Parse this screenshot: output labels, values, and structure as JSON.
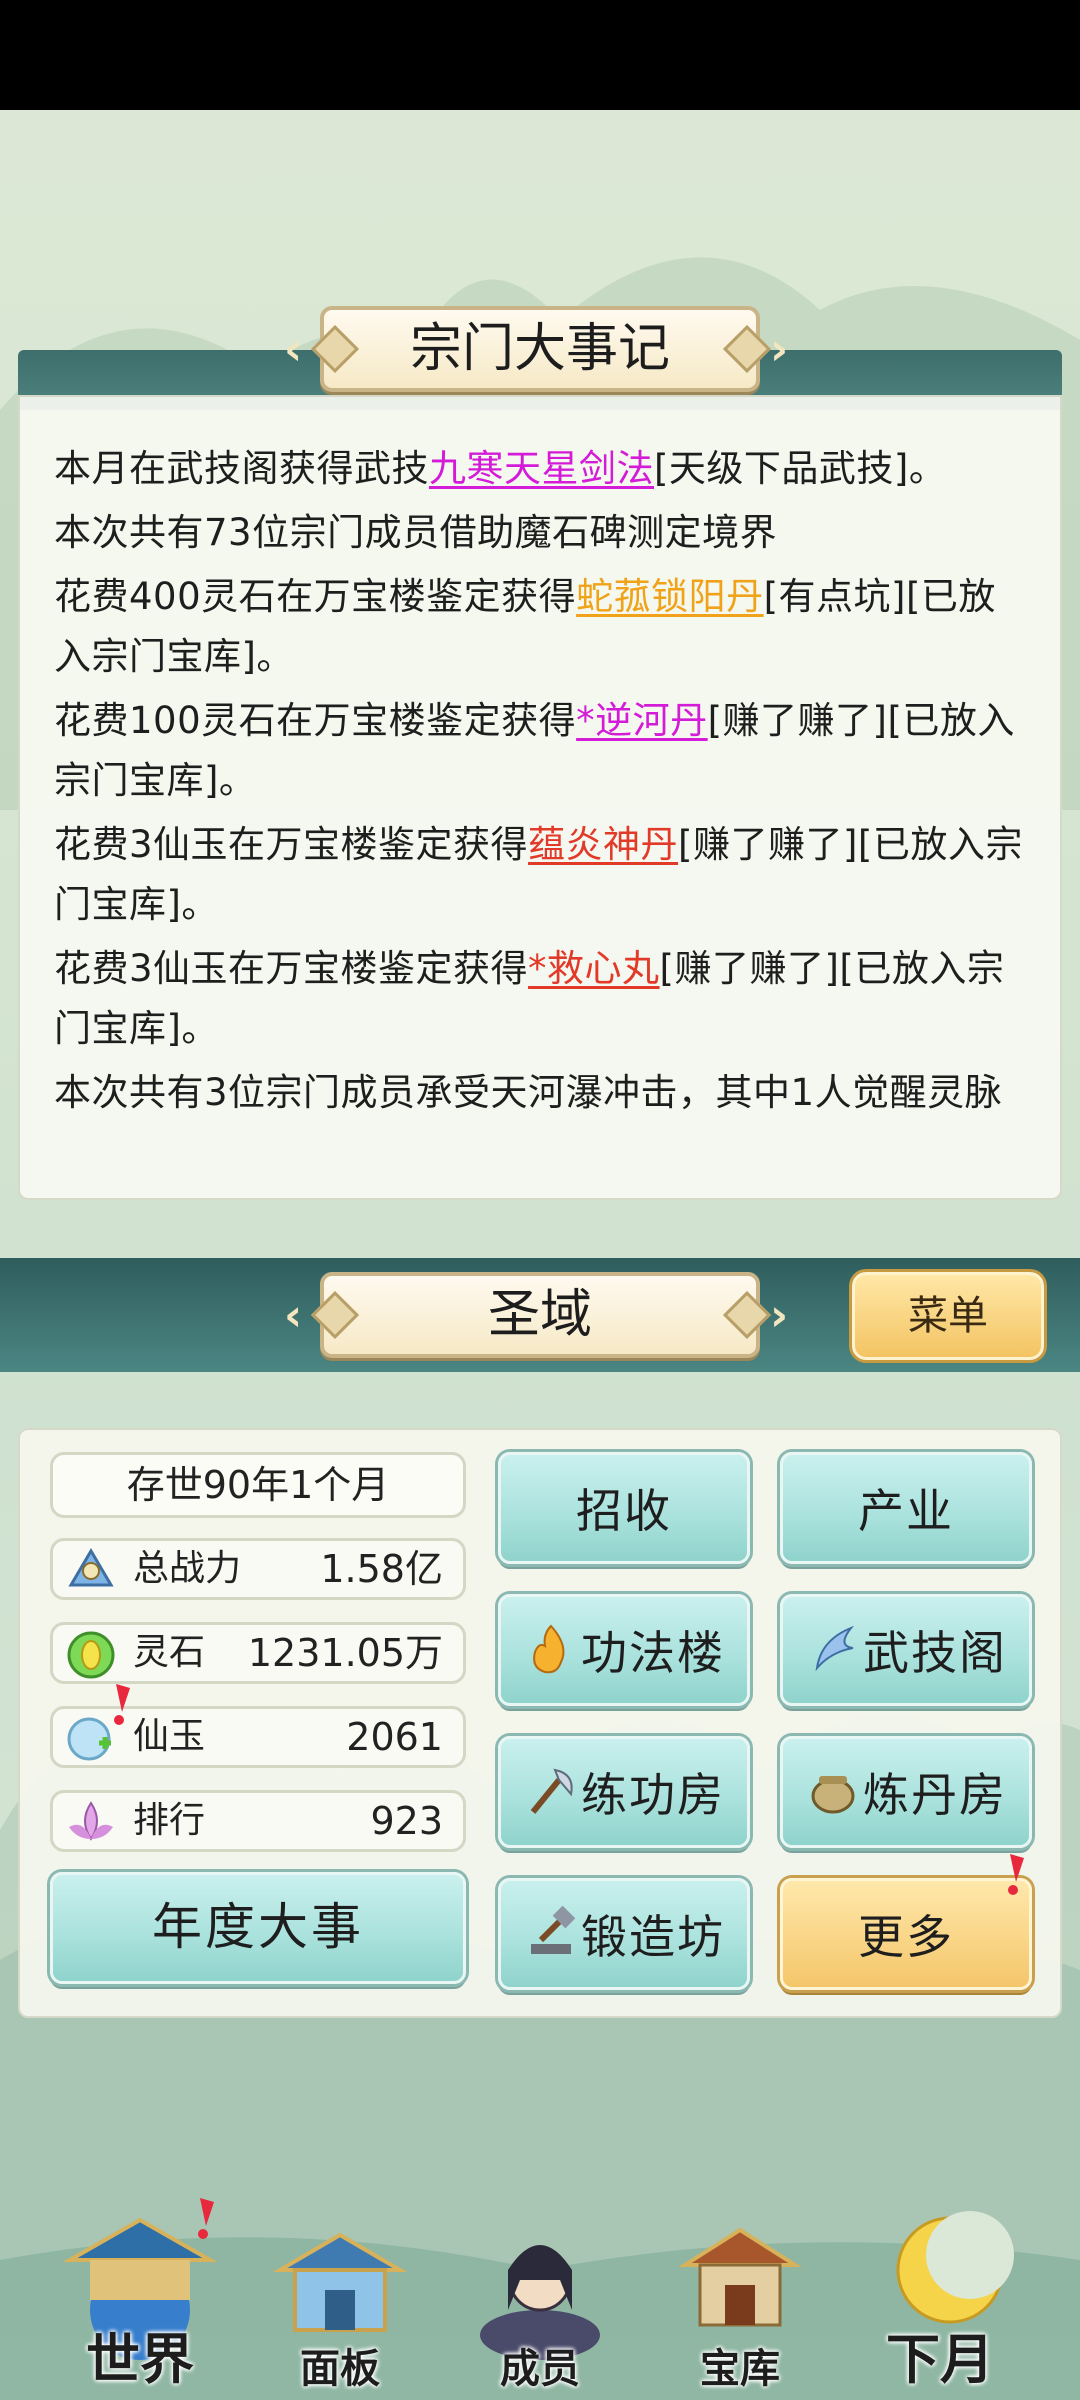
{
  "events": {
    "title": "宗门大事记",
    "lines": [
      {
        "pre": "本月在武技阁获得武技",
        "hl": "九寒天星剑法",
        "post": "[天级下品武技]。"
      },
      {
        "pre": "本次共有73位宗门成员借助魔石碑测定境界",
        "hl": "",
        "post": ""
      },
      {
        "pre": "花费400灵石在万宝楼鉴定获得",
        "hl": "蛇菰锁阳丹",
        "post": "[有点坑][已放入宗门宝库]。"
      },
      {
        "pre": "花费100灵石在万宝楼鉴定获得",
        "hl": "*逆河丹",
        "post": "[赚了赚了][已放入宗门宝库]。"
      },
      {
        "pre": "花费3仙玉在万宝楼鉴定获得",
        "hl": "蕴炎神丹",
        "post": "[赚了赚了][已放入宗门宝库]。"
      },
      {
        "pre": "花费3仙玉在万宝楼鉴定获得",
        "hl": "*救心丸",
        "post": "[赚了赚了][已放入宗门宝库]。"
      },
      {
        "pre": "本次共有3位宗门成员承受天河瀑冲击，其中1人觉醒灵脉",
        "hl": "",
        "post": ""
      }
    ]
  },
  "colors": {
    "purple": "#d41bd8",
    "orange": "#f0a218",
    "red": "#e23a28"
  },
  "holy": {
    "title": "圣域",
    "menu_label": "菜单"
  },
  "stats": {
    "age": "存世90年1个月",
    "power_label": "总战力",
    "power_value": "1.58亿",
    "stone_label": "灵石",
    "stone_value": "1231.05万",
    "jade_label": "仙玉",
    "jade_value": "2061",
    "rank_label": "排行",
    "rank_value": "923"
  },
  "buttons": {
    "recruit": "招收",
    "industry": "产业",
    "technique_hall": "功法楼",
    "martial_pavilion": "武技阁",
    "training_room": "练功房",
    "alchemy_room": "炼丹房",
    "forge": "锻造坊",
    "more": "更多",
    "annual_events": "年度大事"
  },
  "nav": {
    "world": "世界",
    "panel": "面板",
    "members": "成员",
    "treasury": "宝库",
    "next_month": "下月"
  }
}
